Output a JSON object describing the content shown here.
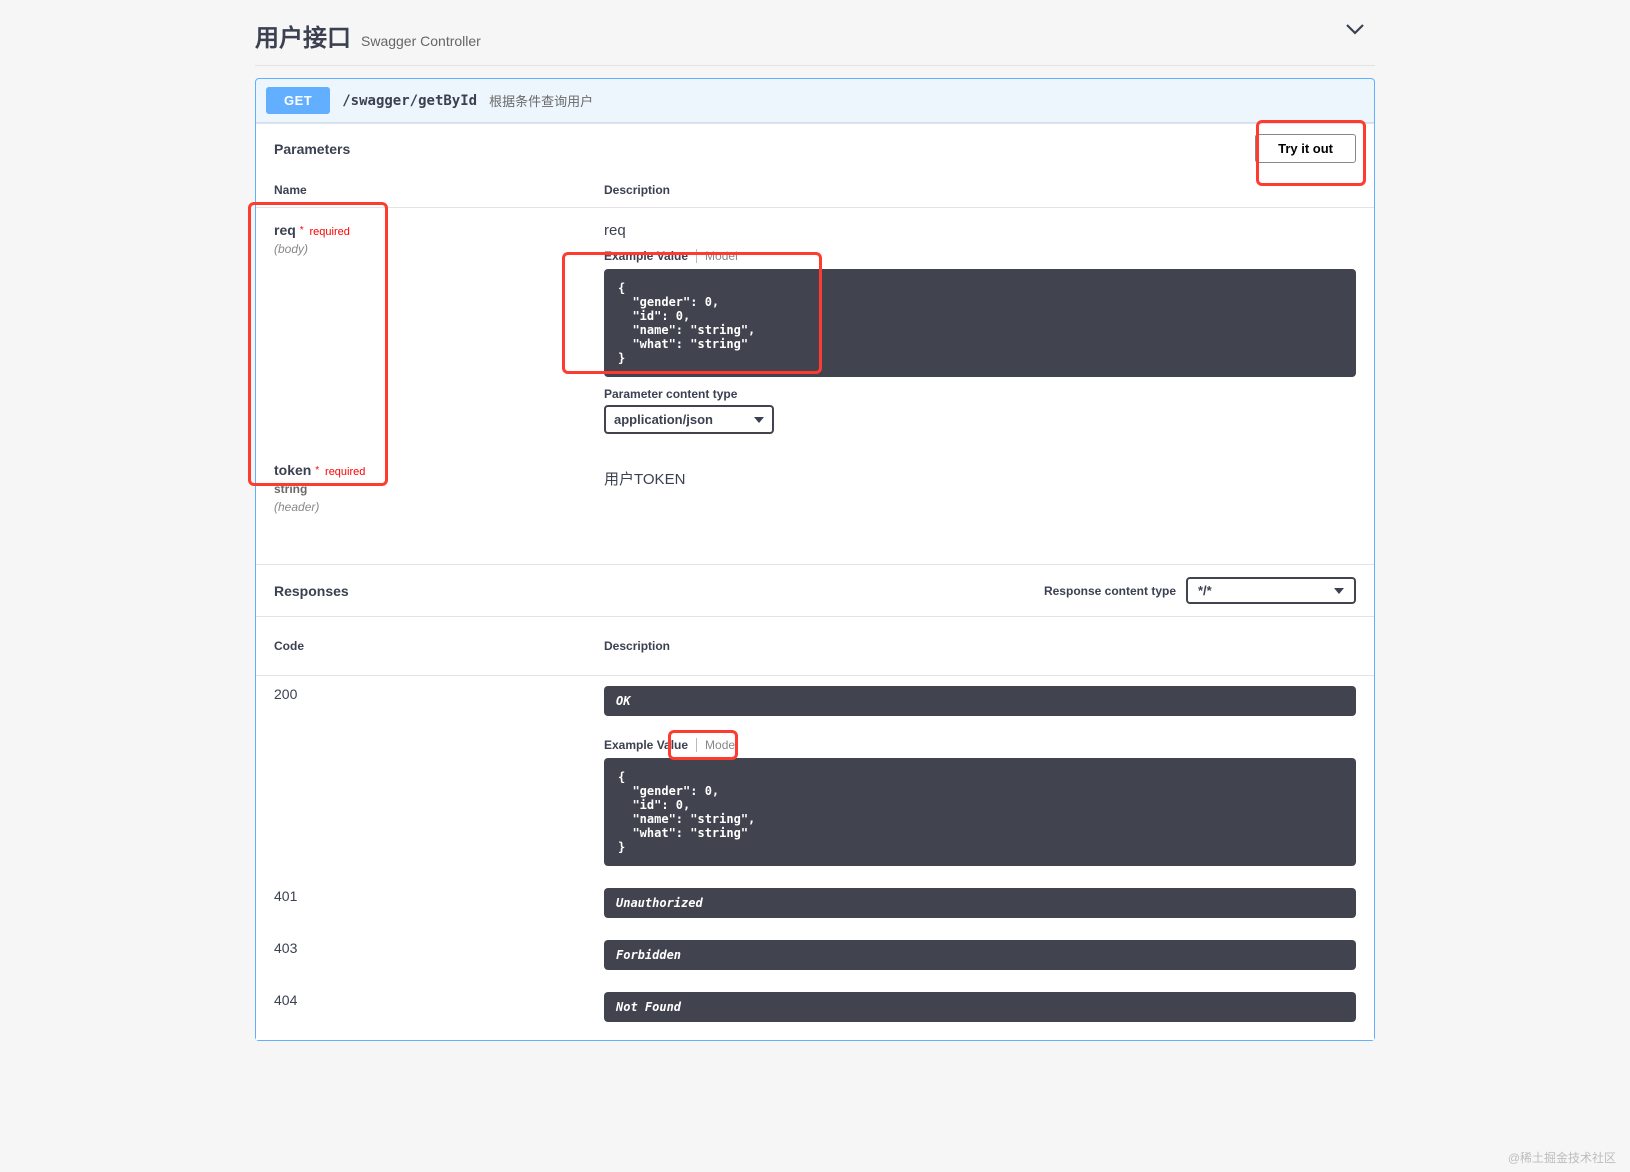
{
  "section": {
    "title": "用户接口",
    "subtitle": "Swagger Controller"
  },
  "operation": {
    "method": "GET",
    "path": "/swagger/getById",
    "summary": "根据条件查询用户"
  },
  "parameters": {
    "panel_title": "Parameters",
    "try_it_out": "Try it out",
    "col_name": "Name",
    "col_description": "Description",
    "rows": [
      {
        "name": "req",
        "required_label": "required",
        "in_label": "(body)",
        "description": "req",
        "tab_example": "Example Value",
        "tab_model": "Model",
        "example": "{\n  \"gender\": 0,\n  \"id\": 0,\n  \"name\": \"string\",\n  \"what\": \"string\"\n}",
        "content_type_label": "Parameter content type",
        "content_type_value": "application/json"
      },
      {
        "name": "token",
        "required_label": "required",
        "type": "string",
        "in_label": "(header)",
        "description": "用户TOKEN"
      }
    ]
  },
  "responses": {
    "panel_title": "Responses",
    "rct_label": "Response content type",
    "rct_value": "*/*",
    "col_code": "Code",
    "col_description": "Description",
    "rows": [
      {
        "code": "200",
        "desc": "OK",
        "tab_example": "Example Value",
        "tab_model": "Model",
        "example": "{\n  \"gender\": 0,\n  \"id\": 0,\n  \"name\": \"string\",\n  \"what\": \"string\"\n}"
      },
      {
        "code": "401",
        "desc": "Unauthorized"
      },
      {
        "code": "403",
        "desc": "Forbidden"
      },
      {
        "code": "404",
        "desc": "Not Found"
      }
    ]
  },
  "watermark": "@稀土掘金技术社区"
}
